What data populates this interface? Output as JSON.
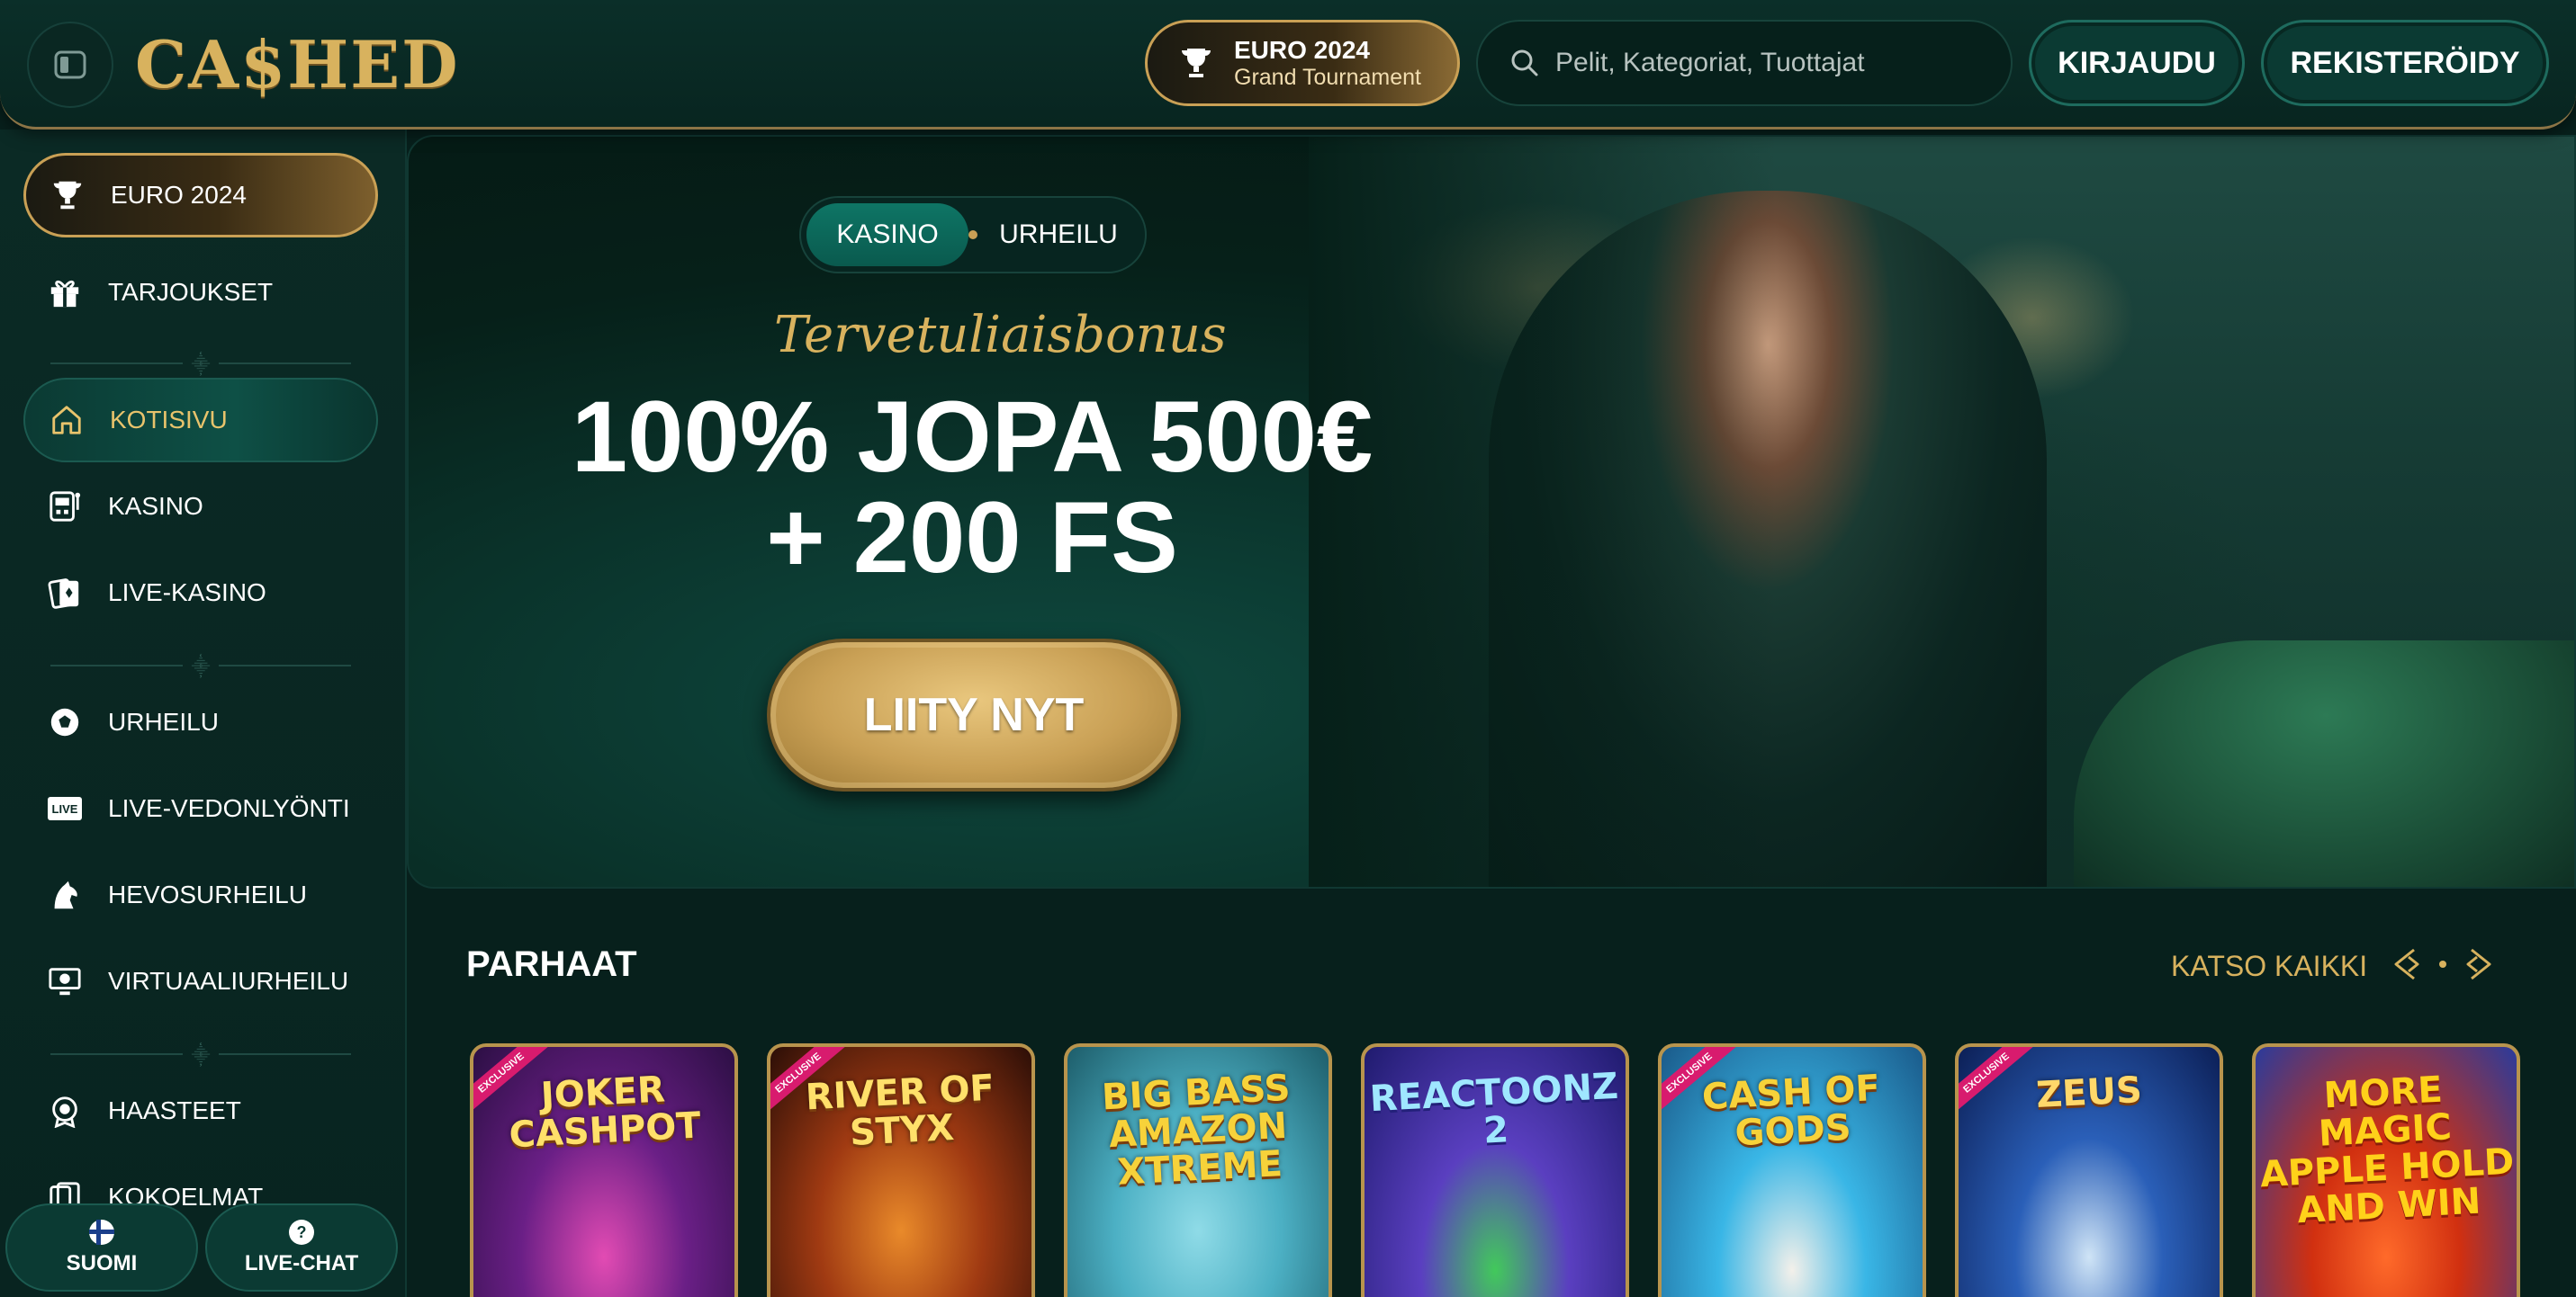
{
  "brand": {
    "logo_text": "CA$HED"
  },
  "header": {
    "euro_badge": {
      "title": "EURO 2024",
      "subtitle": "Grand Tournament"
    },
    "search": {
      "placeholder": "Pelit, Kategoriat, Tuottajat"
    },
    "login_label": "KIRJAUDU",
    "register_label": "REKISTERÖIDY"
  },
  "sidebar": {
    "items": [
      {
        "label": "EURO 2024",
        "icon": "trophy-icon"
      },
      {
        "label": "TARJOUKSET",
        "icon": "gift-icon"
      },
      {
        "label": "KOTISIVU",
        "icon": "home-icon"
      },
      {
        "label": "KASINO",
        "icon": "slot-machine-icon"
      },
      {
        "label": "LIVE-KASINO",
        "icon": "cards-icon"
      },
      {
        "label": "URHEILU",
        "icon": "soccer-ball-icon"
      },
      {
        "label": "LIVE-VEDONLYÖNTI",
        "icon": "live-badge-icon"
      },
      {
        "label": "HEVOSURHEILU",
        "icon": "horse-icon"
      },
      {
        "label": "VIRTUAALIURHEILU",
        "icon": "virtual-sports-icon"
      },
      {
        "label": "HAASTEET",
        "icon": "badge-icon"
      },
      {
        "label": "KOKOELMAT",
        "icon": "collection-icon"
      }
    ],
    "language_label": "SUOMI",
    "chat_label": "LIVE-CHAT"
  },
  "hero": {
    "tabs": [
      "KASINO",
      "URHEILU"
    ],
    "script_title": "Tervetuliaisbonus",
    "headline_line1": "100% JOPA 500€",
    "headline_line2": "+ 200 FS",
    "cta_label": "LIITY NYT"
  },
  "top_games": {
    "title": "PARHAAT",
    "see_all_label": "KATSO KAIKKI",
    "games": [
      {
        "name": "JOKER CASHPOT",
        "badge": "EXCLUSIVE"
      },
      {
        "name": "RIVER OF STYX",
        "badge": "EXCLUSIVE"
      },
      {
        "name": "BIG BASS AMAZON XTREME",
        "badge": ""
      },
      {
        "name": "REACTOONZ 2",
        "badge": ""
      },
      {
        "name": "CASH OF GODS",
        "badge": "EXCLUSIVE"
      },
      {
        "name": "ZEUS",
        "badge": "EXCLUSIVE"
      },
      {
        "name": "MORE MAGIC APPLE HOLD AND WIN",
        "badge": ""
      }
    ]
  },
  "colors": {
    "gold": "#d8b25e",
    "teal": "#0b3a33",
    "background": "#07201c"
  }
}
